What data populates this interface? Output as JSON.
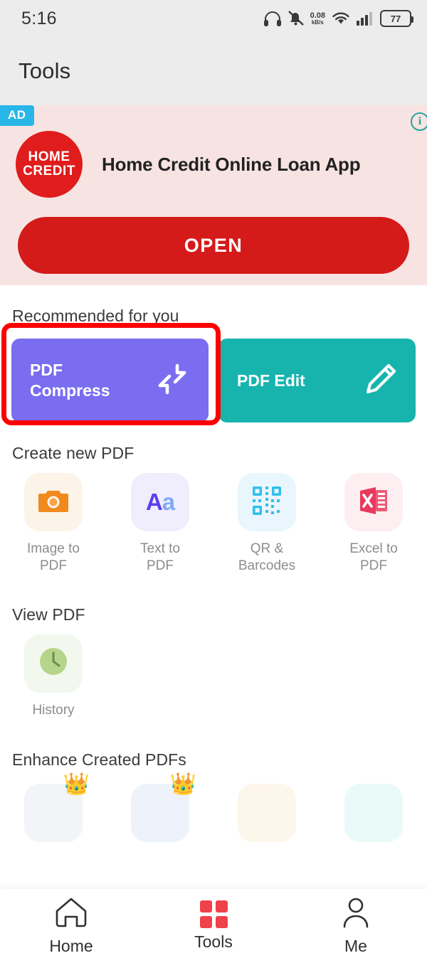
{
  "status_bar": {
    "time": "5:16",
    "icons": [
      "headphones-icon",
      "bell-muted-icon",
      "network-speed-icon",
      "wifi-icon",
      "signal-icon",
      "battery-icon"
    ],
    "net_speed_value": "0.08",
    "net_speed_unit": "kB/s",
    "battery_level": "77"
  },
  "header": {
    "title": "Tools"
  },
  "ad": {
    "badge": "AD",
    "info_glyph": "i",
    "logo_line1": "HOME",
    "logo_line2": "CREDIT",
    "headline": "Home Credit Online Loan App",
    "cta_label": "OPEN",
    "background": "#f7e4e2",
    "cta_color": "#d51a1a",
    "badge_color": "#29b6e8"
  },
  "recommended": {
    "title": "Recommended for you",
    "cards": [
      {
        "label_line1": "PDF",
        "label_line2": "Compress",
        "color": "#7b6df0",
        "icon": "compress-arrows-icon",
        "highlighted": true
      },
      {
        "label_line1": "PDF Edit",
        "label_line2": "",
        "color": "#17b4ae",
        "icon": "pencil-icon",
        "highlighted": false
      }
    ],
    "highlight_color": "#ff0000"
  },
  "create_new_pdf": {
    "title": "Create new PDF",
    "items": [
      {
        "label_line1": "Image to",
        "label_line2": "PDF",
        "icon": "camera-icon",
        "tile_color": "#fdf4e9",
        "icon_color": "#f08a1e"
      },
      {
        "label_line1": "Text to",
        "label_line2": "PDF",
        "icon": "text-aa-icon",
        "tile_color": "#f0eefd",
        "icon_color": "#6a4df0"
      },
      {
        "label_line1": "QR &",
        "label_line2": "Barcodes",
        "icon": "qr-code-icon",
        "tile_color": "#eaf6fd",
        "icon_color": "#2fc0ea"
      },
      {
        "label_line1": "Excel to",
        "label_line2": "PDF",
        "icon": "excel-icon",
        "tile_color": "#fdeef1",
        "icon_color": "#e8395e"
      }
    ]
  },
  "view_pdf": {
    "title": "View PDF",
    "items": [
      {
        "label_line1": "History",
        "label_line2": "",
        "icon": "clock-icon",
        "tile_color": "#f2f8ee",
        "icon_color": "#b6d48a"
      }
    ]
  },
  "enhance": {
    "title": "Enhance Created PDFs",
    "items": [
      {
        "tile_color": "#f3f4f8",
        "crown": "👑"
      },
      {
        "tile_color": "#eef3fb",
        "crown": "👑"
      },
      {
        "tile_color": "#fdf6ea",
        "crown": ""
      },
      {
        "tile_color": "#eafaf9",
        "crown": ""
      }
    ]
  },
  "bottom_nav": {
    "items": [
      {
        "label": "Home",
        "icon": "home-icon",
        "active": false
      },
      {
        "label": "Tools",
        "icon": "grid-icon",
        "active": true
      },
      {
        "label": "Me",
        "icon": "person-icon",
        "active": false
      }
    ],
    "active_color": "#f0424a"
  }
}
